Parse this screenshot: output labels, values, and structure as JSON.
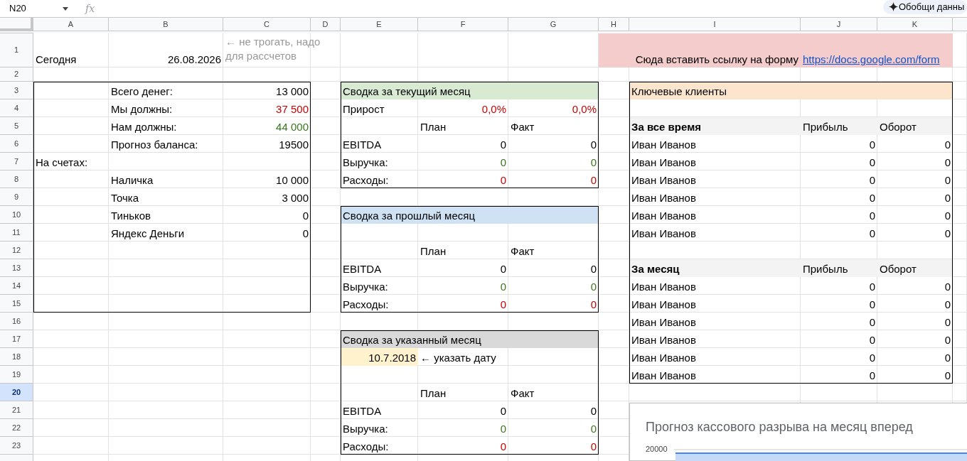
{
  "toolbar": {
    "name_box": "N20",
    "formula_label": "fx",
    "ai_button": "Обобщи данны"
  },
  "columns": [
    "A",
    "B",
    "C",
    "D",
    "E",
    "F",
    "G",
    "H",
    "I",
    "J",
    "K"
  ],
  "rows": [
    {
      "number": "1",
      "selected": false,
      "cells": [
        {
          "text": "Сегодня",
          "kind": "text"
        },
        {
          "text": "26.08.2026",
          "kind": "value"
        },
        {
          "text": "← не трогать, надо для рассчетов",
          "kind": "note"
        },
        {
          "merged": true
        },
        null,
        null,
        null,
        {
          "text": "Сюда вставить ссылку на форму",
          "kind": "value",
          "color": "#f4cccc",
          "filled": true
        },
        {
          "merged": true
        },
        {
          "text": "https://docs.google.com/form",
          "kind": "link",
          "color": "#f4cccc",
          "filled": true
        },
        {
          "merged": true
        }
      ]
    },
    {
      "number": "2",
      "selected": false,
      "cells": []
    },
    {
      "number": "3",
      "selected": false,
      "cells": [
        null,
        {
          "text": "Всего денег:",
          "kind": "text"
        },
        {
          "text": "13 000",
          "kind": "value"
        },
        null,
        {
          "text": "Сводка за текущий месяц",
          "kind": "text",
          "color": "#d9ead3",
          "filled": true
        },
        {
          "merged": true
        },
        {
          "merged": true
        },
        null,
        {
          "text": "Ключевые клиенты",
          "kind": "text",
          "color": "#fce5cd",
          "filled": true
        },
        {
          "merged": true
        },
        {
          "merged": true
        }
      ]
    },
    {
      "number": "4",
      "selected": false,
      "cells": [
        null,
        {
          "text": "Мы должны:",
          "kind": "text"
        },
        {
          "text": "37 500",
          "kind": "value",
          "color": "#cc0000",
          "filled": false
        },
        null,
        {
          "text": "Прирост",
          "kind": "text"
        },
        {
          "text": "0,0%",
          "kind": "value",
          "color": "#cc0000",
          "filled": false
        },
        {
          "text": "0,0%",
          "kind": "value",
          "color": "#cc0000",
          "filled": false
        }
      ]
    },
    {
      "number": "5",
      "selected": false,
      "cells": [
        null,
        {
          "text": "Нам должны:",
          "kind": "text"
        },
        {
          "text": "44 000",
          "kind": "value",
          "color": "#38761d",
          "filled": false
        },
        null,
        null,
        {
          "text": "План",
          "kind": "text"
        },
        {
          "text": "Факт",
          "kind": "text"
        },
        null,
        {
          "text": "За все время",
          "kind": "text",
          "bold": true,
          "color": "#f3f3f3",
          "filled": true
        },
        {
          "text": "Прибыль",
          "kind": "text",
          "color": "#f3f3f3",
          "filled": true
        },
        {
          "text": "Оборот",
          "kind": "text",
          "color": "#f3f3f3",
          "filled": true
        }
      ]
    },
    {
      "number": "6",
      "selected": false,
      "cells": [
        null,
        {
          "text": "Прогноз баланса:",
          "kind": "text"
        },
        {
          "text": "19500",
          "kind": "value"
        },
        null,
        {
          "text": "EBITDA",
          "kind": "text"
        },
        {
          "text": "0",
          "kind": "value"
        },
        {
          "text": "0",
          "kind": "value"
        },
        null,
        {
          "text": "Иван Иванов",
          "kind": "text"
        },
        {
          "text": "0",
          "kind": "value"
        },
        {
          "text": "0",
          "kind": "value"
        }
      ]
    },
    {
      "number": "7",
      "selected": false,
      "cells": [
        {
          "text": "На счетах:",
          "kind": "text"
        },
        null,
        null,
        null,
        {
          "text": "Выручка:",
          "kind": "text"
        },
        {
          "text": "0",
          "kind": "value",
          "color": "#38761d",
          "filled": false
        },
        {
          "text": "0",
          "kind": "value",
          "color": "#38761d",
          "filled": false
        },
        null,
        {
          "text": "Иван Иванов",
          "kind": "text"
        },
        {
          "text": "0",
          "kind": "value"
        },
        {
          "text": "0",
          "kind": "value"
        }
      ]
    },
    {
      "number": "8",
      "selected": false,
      "cells": [
        null,
        {
          "text": "Наличка",
          "kind": "text"
        },
        {
          "text": "10 000",
          "kind": "value"
        },
        null,
        {
          "text": "Расходы:",
          "kind": "text"
        },
        {
          "text": "0",
          "kind": "value",
          "color": "#cc0000",
          "filled": false
        },
        {
          "text": "0",
          "kind": "value",
          "color": "#cc0000",
          "filled": false
        },
        null,
        {
          "text": "Иван Иванов",
          "kind": "text"
        },
        {
          "text": "0",
          "kind": "value"
        },
        {
          "text": "0",
          "kind": "value"
        }
      ]
    },
    {
      "number": "9",
      "selected": false,
      "cells": [
        null,
        {
          "text": "Точка",
          "kind": "text"
        },
        {
          "text": "3 000",
          "kind": "value"
        },
        null,
        null,
        null,
        null,
        null,
        {
          "text": "Иван Иванов",
          "kind": "text"
        },
        {
          "text": "0",
          "kind": "value"
        },
        {
          "text": "0",
          "kind": "value"
        }
      ]
    },
    {
      "number": "10",
      "selected": false,
      "cells": [
        null,
        {
          "text": "Тиньков",
          "kind": "text"
        },
        {
          "text": "0",
          "kind": "value"
        },
        null,
        {
          "text": "Сводка за прошлый месяц",
          "kind": "text",
          "color": "#cfe2f3",
          "filled": true
        },
        {
          "merged": true
        },
        {
          "merged": true
        },
        null,
        {
          "text": "Иван Иванов",
          "kind": "text"
        },
        {
          "text": "0",
          "kind": "value"
        },
        {
          "text": "0",
          "kind": "value"
        }
      ]
    },
    {
      "number": "11",
      "selected": false,
      "cells": [
        null,
        {
          "text": "Яндекс Деньги",
          "kind": "text"
        },
        {
          "text": "0",
          "kind": "value"
        },
        null,
        null,
        null,
        null,
        null,
        {
          "text": "Иван Иванов",
          "kind": "text"
        },
        {
          "text": "0",
          "kind": "value"
        },
        {
          "text": "0",
          "kind": "value"
        }
      ]
    },
    {
      "number": "12",
      "selected": false,
      "cells": [
        null,
        null,
        null,
        null,
        null,
        {
          "text": "План",
          "kind": "text"
        },
        {
          "text": "Факт",
          "kind": "text"
        }
      ]
    },
    {
      "number": "13",
      "selected": false,
      "cells": [
        null,
        null,
        null,
        null,
        {
          "text": "EBITDA",
          "kind": "text"
        },
        {
          "text": "0",
          "kind": "value"
        },
        {
          "text": "0",
          "kind": "value"
        },
        null,
        {
          "text": "За месяц",
          "kind": "text",
          "bold": true,
          "color": "#f3f3f3",
          "filled": true
        },
        {
          "text": "Прибыль",
          "kind": "text",
          "color": "#f3f3f3",
          "filled": true
        },
        {
          "text": "Оборот",
          "kind": "text",
          "color": "#f3f3f3",
          "filled": true
        }
      ]
    },
    {
      "number": "14",
      "selected": false,
      "cells": [
        null,
        null,
        null,
        null,
        {
          "text": "Выручка:",
          "kind": "text"
        },
        {
          "text": "0",
          "kind": "value",
          "color": "#38761d",
          "filled": false
        },
        {
          "text": "0",
          "kind": "value",
          "color": "#38761d",
          "filled": false
        },
        null,
        {
          "text": "Иван Иванов",
          "kind": "text"
        },
        {
          "text": "0",
          "kind": "value"
        },
        {
          "text": "0",
          "kind": "value"
        }
      ]
    },
    {
      "number": "15",
      "selected": false,
      "cells": [
        null,
        null,
        null,
        null,
        {
          "text": "Расходы:",
          "kind": "text"
        },
        {
          "text": "0",
          "kind": "value",
          "color": "#cc0000",
          "filled": false
        },
        {
          "text": "0",
          "kind": "value",
          "color": "#cc0000",
          "filled": false
        },
        null,
        {
          "text": "Иван Иванов",
          "kind": "text"
        },
        {
          "text": "0",
          "kind": "value"
        },
        {
          "text": "0",
          "kind": "value"
        }
      ]
    },
    {
      "number": "16",
      "selected": false,
      "cells": [
        null,
        null,
        null,
        null,
        null,
        null,
        null,
        null,
        {
          "text": "Иван Иванов",
          "kind": "text"
        },
        {
          "text": "0",
          "kind": "value"
        },
        {
          "text": "0",
          "kind": "value"
        }
      ]
    },
    {
      "number": "17",
      "selected": false,
      "cells": [
        null,
        null,
        null,
        null,
        {
          "text": "Сводка за указанный месяц",
          "kind": "text",
          "color": "#d9d9d9",
          "filled": true
        },
        {
          "merged": true
        },
        {
          "merged": true
        },
        null,
        {
          "text": "Иван Иванов",
          "kind": "text"
        },
        {
          "text": "0",
          "kind": "value"
        },
        {
          "text": "0",
          "kind": "value"
        }
      ]
    },
    {
      "number": "18",
      "selected": false,
      "cells": [
        null,
        null,
        null,
        null,
        {
          "text": "10.7.2018",
          "kind": "value",
          "color": "#fff2cc",
          "filled": true
        },
        {
          "text": "← указать дату",
          "kind": "text"
        },
        {
          "merged": true
        },
        null,
        {
          "text": "Иван Иванов",
          "kind": "text"
        },
        {
          "text": "0",
          "kind": "value"
        },
        {
          "text": "0",
          "kind": "value"
        }
      ]
    },
    {
      "number": "19",
      "selected": false,
      "cells": [
        null,
        null,
        null,
        null,
        null,
        null,
        null,
        null,
        {
          "text": "Иван Иванов",
          "kind": "text"
        },
        {
          "text": "0",
          "kind": "value"
        },
        {
          "text": "0",
          "kind": "value"
        }
      ]
    },
    {
      "number": "20",
      "selected": true,
      "cells": [
        null,
        null,
        null,
        null,
        null,
        {
          "text": "План",
          "kind": "text"
        },
        {
          "text": "Факт",
          "kind": "text"
        }
      ]
    },
    {
      "number": "21",
      "selected": false,
      "cells": [
        null,
        null,
        null,
        null,
        {
          "text": "EBITDA",
          "kind": "text"
        },
        {
          "text": "0",
          "kind": "value"
        },
        {
          "text": "0",
          "kind": "value"
        }
      ]
    },
    {
      "number": "22",
      "selected": false,
      "cells": [
        null,
        null,
        null,
        null,
        {
          "text": "Выручка:",
          "kind": "text"
        },
        {
          "text": "0",
          "kind": "value",
          "color": "#38761d",
          "filled": false
        },
        {
          "text": "0",
          "kind": "value",
          "color": "#38761d",
          "filled": false
        }
      ]
    },
    {
      "number": "23",
      "selected": false,
      "cells": [
        null,
        null,
        null,
        null,
        {
          "text": "Расходы:",
          "kind": "text"
        },
        {
          "text": "0",
          "kind": "value",
          "color": "#cc0000",
          "filled": false
        },
        {
          "text": "0",
          "kind": "value",
          "color": "#cc0000",
          "filled": false
        }
      ]
    }
  ],
  "chart": {
    "title": "Прогноз кассового разрыва на месяц вперед",
    "tick_label": "20000"
  }
}
